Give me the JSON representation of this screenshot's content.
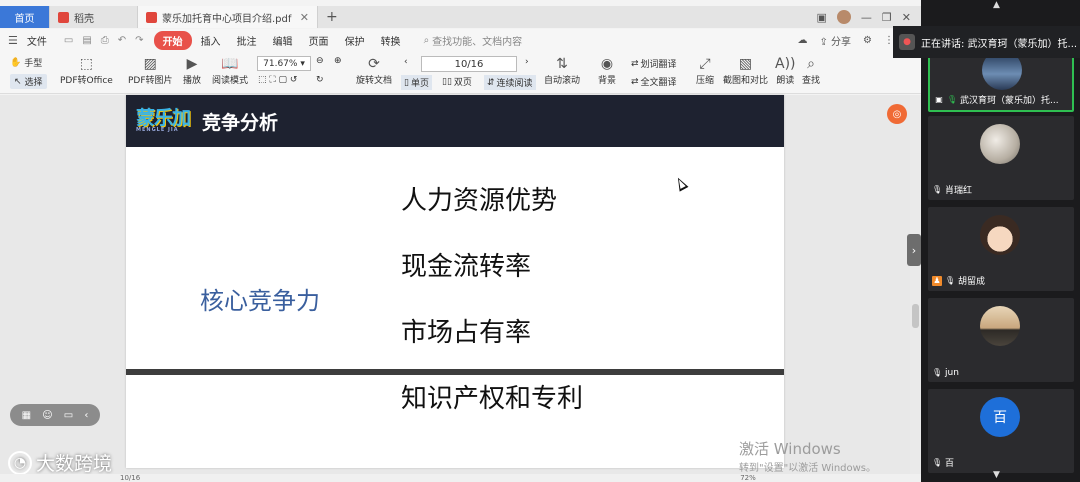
{
  "tabs": {
    "home": "首页",
    "daoke": "稻壳",
    "doc": "蒙乐加托育中心项目介绍.pdf",
    "add": "+"
  },
  "menu": {
    "file": "文件",
    "items": [
      "开始",
      "插入",
      "批注",
      "编辑",
      "页面",
      "保护",
      "转换"
    ],
    "search_placeholder": "查找功能、文档内容",
    "share": "分享"
  },
  "toolbar": {
    "hand": "手型",
    "select": "选择",
    "pdf_to_office": "PDF转Office",
    "pdf_to_image": "PDF转图片",
    "play": "播放",
    "read_mode": "阅读模式",
    "zoom": "71.67%",
    "rotate": "旋转文档",
    "page": "10/16",
    "single": "单页",
    "double": "双页",
    "continuous": "连续阅读",
    "auto_scroll": "自动滚动",
    "background": "背景",
    "translate_word": "划词翻译",
    "translate_all": "全文翻译",
    "compress": "压缩",
    "compare": "截图和对比",
    "read_aloud": "朗读",
    "find": "查找"
  },
  "slide": {
    "logo": "蒙乐加",
    "logo_sub": "MENGLE JIA",
    "title": "竞争分析",
    "core": "核心竞争力",
    "items": [
      "人力资源优势",
      "现金流转率",
      "市场占有率",
      "知识产权和专利"
    ]
  },
  "watermark": {
    "line1": "激活 Windows",
    "line2": "转到\"设置\"以激活 Windows。"
  },
  "brand_watermark": "大数跨境",
  "status": {
    "page": "10/16",
    "zoom": "72%"
  },
  "meeting": {
    "speaking": "正在讲话: 武汉育珂（蒙乐加）托...",
    "participants": [
      {
        "name": "武汉育珂（蒙乐加）托..."
      },
      {
        "name": "肖瑞红"
      },
      {
        "name": "胡留成"
      },
      {
        "name": "jun"
      },
      {
        "name": "百",
        "initial": "百"
      }
    ]
  },
  "colors": {
    "accent_red": "#e8514a",
    "slide_header": "#1e2230",
    "core_blue": "#3a5f9e",
    "active_speaker": "#2fbf51"
  }
}
